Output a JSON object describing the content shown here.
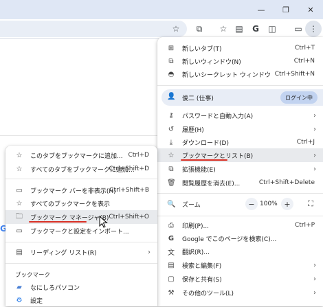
{
  "window_controls": {
    "minimize": "—",
    "restore": "❐",
    "close": "✕"
  },
  "toolbar_icons": [
    "star-icon",
    "extensions-icon",
    "bookmark-star-icon",
    "reading-list-icon",
    "google-icon",
    "side-panel-icon",
    "device-icon",
    "menu-icon"
  ],
  "main_menu": {
    "new_tab": {
      "label": "新しいタブ(T)",
      "shortcut": "Ctrl+T"
    },
    "new_window": {
      "label": "新しいウィンドウ(N)",
      "shortcut": "Ctrl+N"
    },
    "incognito": {
      "label": "新しいシークレット ウィンドウ",
      "shortcut": "Ctrl+Shift+N"
    },
    "profile": {
      "name": "俊二 (仕事)",
      "login": "ログイン中"
    },
    "passwords": {
      "label": "パスワードと自動入力(A)"
    },
    "history": {
      "label": "履歴(H)"
    },
    "downloads": {
      "label": "ダウンロード(D)",
      "shortcut": "Ctrl+J"
    },
    "bookmarks": {
      "label": "ブックマークとリスト(B)"
    },
    "extensions": {
      "label": "拡張機能(E)"
    },
    "clear_data": {
      "label": "閲覧履歴を消去(E)...",
      "shortcut": "Ctrl+Shift+Delete"
    },
    "zoom": {
      "label": "ズーム",
      "value": "100%",
      "minus": "−",
      "plus": "+",
      "fullscreen": "⛶"
    },
    "print": {
      "label": "印刷(P)...",
      "shortcut": "Ctrl+P"
    },
    "search_page": {
      "label": "Google でこのページを検索(C)..."
    },
    "translate": {
      "label": "翻訳(R)..."
    },
    "find_edit": {
      "label": "検索と編集(F)"
    },
    "save_share": {
      "label": "保存と共有(S)"
    },
    "more_tools": {
      "label": "その他のツール(L)"
    }
  },
  "bookmark_menu": {
    "bookmark_tab": {
      "label": "このタブをブックマークに追加...",
      "shortcut": "Ctrl+D"
    },
    "bookmark_all": {
      "label": "すべてのタブをブックマークに追加...",
      "shortcut": "Ctrl+Shift+D"
    },
    "hide_bar": {
      "label": "ブックマーク バーを非表示(H)",
      "shortcut": "Ctrl+Shift+B"
    },
    "show_all": {
      "label": "すべてのブックマークを表示"
    },
    "manager": {
      "label": "ブックマーク マネージャ(B)",
      "shortcut": "Ctrl+Shift+O"
    },
    "import": {
      "label": "ブックマークと設定をインポート..."
    },
    "reading_list": {
      "label": "リーディング リスト(R)"
    },
    "section_title": "ブックマーク",
    "folder_item": {
      "label": "なにしろパソコン"
    },
    "settings_item": {
      "label": "設定"
    }
  },
  "arrow": "›"
}
